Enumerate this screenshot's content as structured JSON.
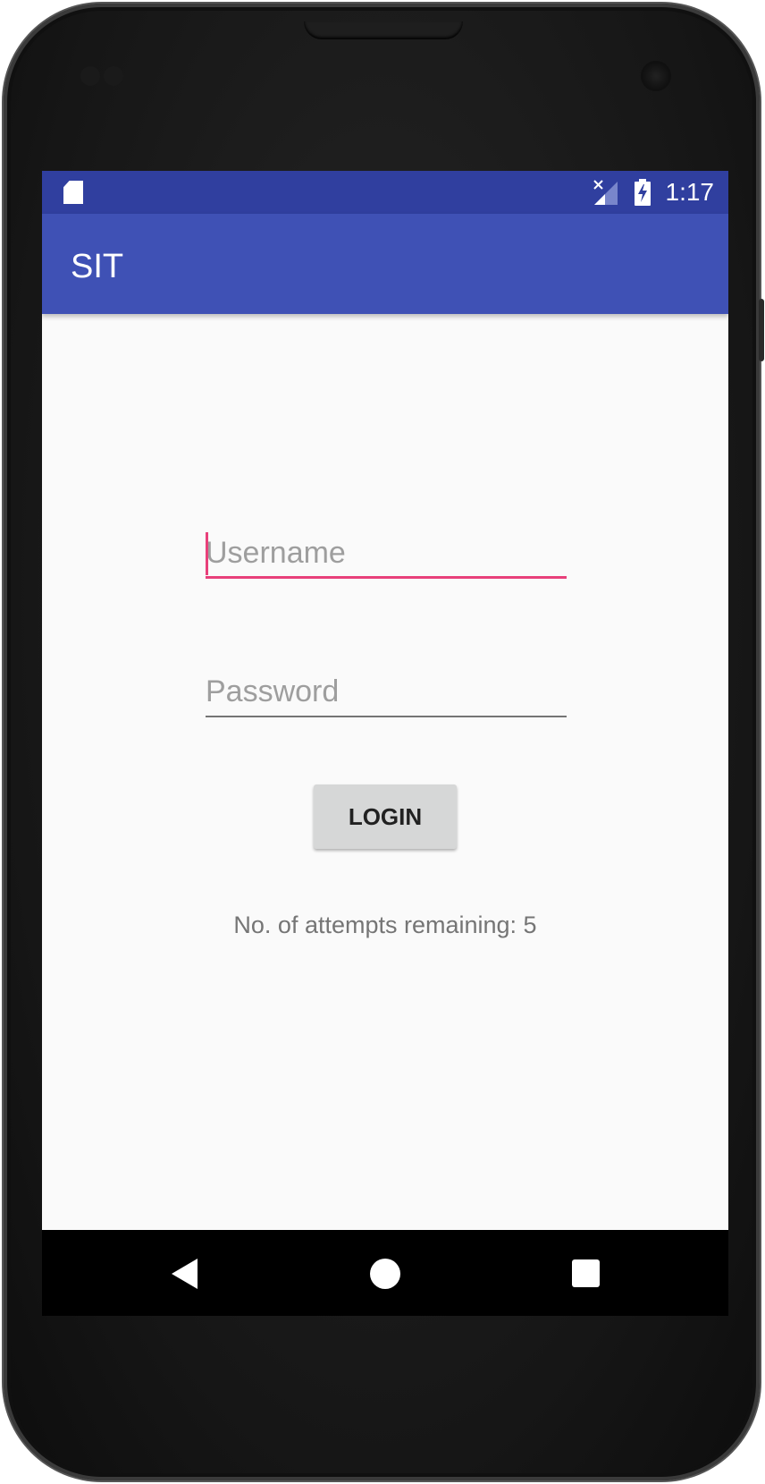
{
  "status_bar": {
    "time": "1:17",
    "icons": [
      "sd-card-icon",
      "signal-no-service-icon",
      "battery-charging-icon"
    ]
  },
  "app_bar": {
    "title": "SIT"
  },
  "login_form": {
    "username_placeholder": "Username",
    "username_value": "",
    "password_placeholder": "Password",
    "password_value": "",
    "login_label": "LOGIN",
    "attempts_text": "No. of attempts remaining: 5"
  },
  "nav_bar": {
    "icons": [
      "back-icon",
      "home-icon",
      "recent-apps-icon"
    ]
  },
  "colors": {
    "status_bar": "#303f9f",
    "app_bar": "#3f51b5",
    "accent": "#e8407a",
    "background": "#fafafa",
    "button": "#d6d7d7"
  }
}
